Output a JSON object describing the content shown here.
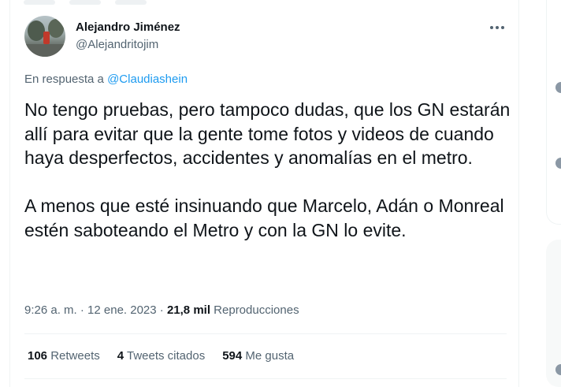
{
  "tweet": {
    "author_name": "Alejandro Jiménez",
    "author_handle": "@Alejandritojim",
    "reply_prefix": "En respuesta a",
    "reply_to": "@Claudiashein",
    "text": "No tengo pruebas, pero tampoco dudas, que los GN estarán allí para evitar que la gente tome fotos y videos de cuando haya desperfectos, accidentes y anomalías en el metro.\n\nA menos que esté insinuando que Marcelo, Adán o Monreal estén saboteando el Metro y con la GN lo evite.",
    "timestamp": "9:26 a. m. · 12 ene. 2023 ·",
    "views_count": "21,8 mil",
    "views_label": "Reproducciones"
  },
  "stats": {
    "retweets_count": "106",
    "retweets_label": "Retweets",
    "quotes_count": "4",
    "quotes_label": "Tweets citados",
    "likes_count": "594",
    "likes_label": "Me gusta"
  },
  "colors": {
    "accent": "#1d9bf0",
    "secondary_text": "#536471",
    "primary_text": "#0f1419",
    "border": "#eff3f4"
  },
  "icons": {
    "more": "more-icon"
  }
}
